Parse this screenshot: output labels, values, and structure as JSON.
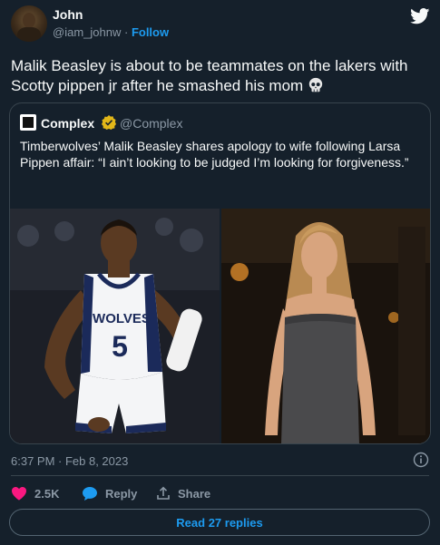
{
  "author": {
    "name": "John",
    "handle": "@iam_johnw",
    "separator": "·",
    "follow_label": "Follow"
  },
  "tweet": {
    "text": "Malik Beasley is about to be teammates on the lakers with Scotty pippen jr after he smashed his mom",
    "emoji_icon": "skull-icon"
  },
  "quote": {
    "name": "Complex",
    "handle": "@Complex",
    "text": "Timberwolves’ Malik Beasley shares apology to wife following Larsa Pippen affair: “I ain’t looking to be judged I’m looking for forgiveness.”",
    "jersey_team": "WOLVES",
    "jersey_number": "5"
  },
  "meta": {
    "timestamp": "6:37 PM · Feb 8, 2023"
  },
  "actions": {
    "likes": "2.5K",
    "reply_label": "Reply",
    "share_label": "Share",
    "read_replies_label": "Read 27 replies"
  },
  "colors": {
    "background": "#15202b",
    "accent": "#1d9bf0",
    "like": "#f91880",
    "muted": "#8b98a5",
    "border": "#38444d"
  }
}
